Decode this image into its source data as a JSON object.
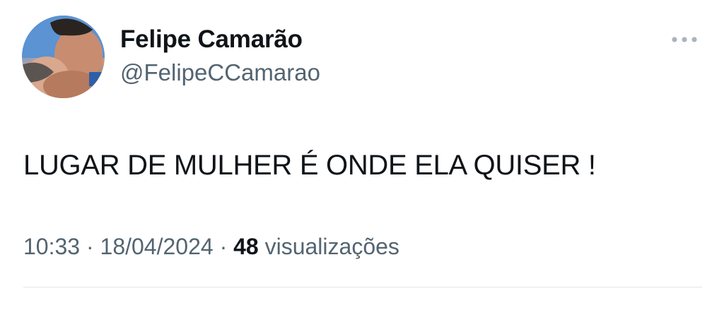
{
  "tweet": {
    "author": {
      "display_name": "Felipe Camarão",
      "handle": "@FelipeCCamarao"
    },
    "more_icon": "more-horizontal-icon",
    "text": "LUGAR DE MULHER É ONDE ELA QUISER !",
    "meta": {
      "time": "10:33",
      "separator": "·",
      "date": "18/04/2024",
      "views_count": "48",
      "views_label": "visualizações"
    }
  }
}
